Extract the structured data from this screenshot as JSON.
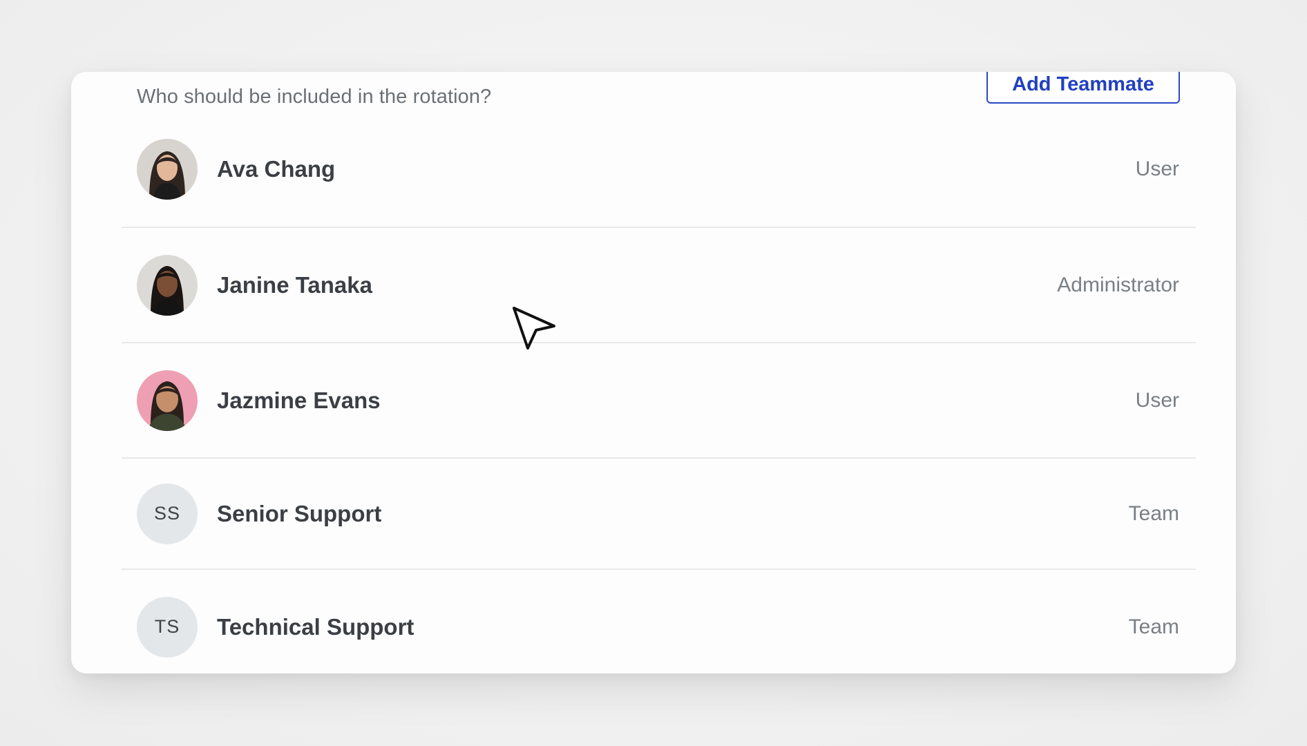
{
  "prompt": "Who should be included in the rotation?",
  "add_button": {
    "label": "Add Teammate"
  },
  "members": [
    {
      "name": "Ava Chang",
      "role": "User",
      "avatar": "photo-avatar"
    },
    {
      "name": "Janine Tanaka",
      "role": "Administrator",
      "avatar": "photo-avatar"
    },
    {
      "name": "Jazmine Evans",
      "role": "User",
      "avatar": "photo-avatar"
    },
    {
      "name": "Senior Support",
      "role": "Team",
      "initials": "SS"
    },
    {
      "name": "Technical Support",
      "role": "Team",
      "initials": "TS"
    }
  ],
  "colors": {
    "accent": "#2140c0",
    "divider": "#e6e8ea",
    "initials_bg": "#e3e7ea",
    "name_text": "#3b3f44",
    "role_text": "#7a7f84"
  },
  "icons": {
    "cursor": "arrow-pointer-icon"
  }
}
